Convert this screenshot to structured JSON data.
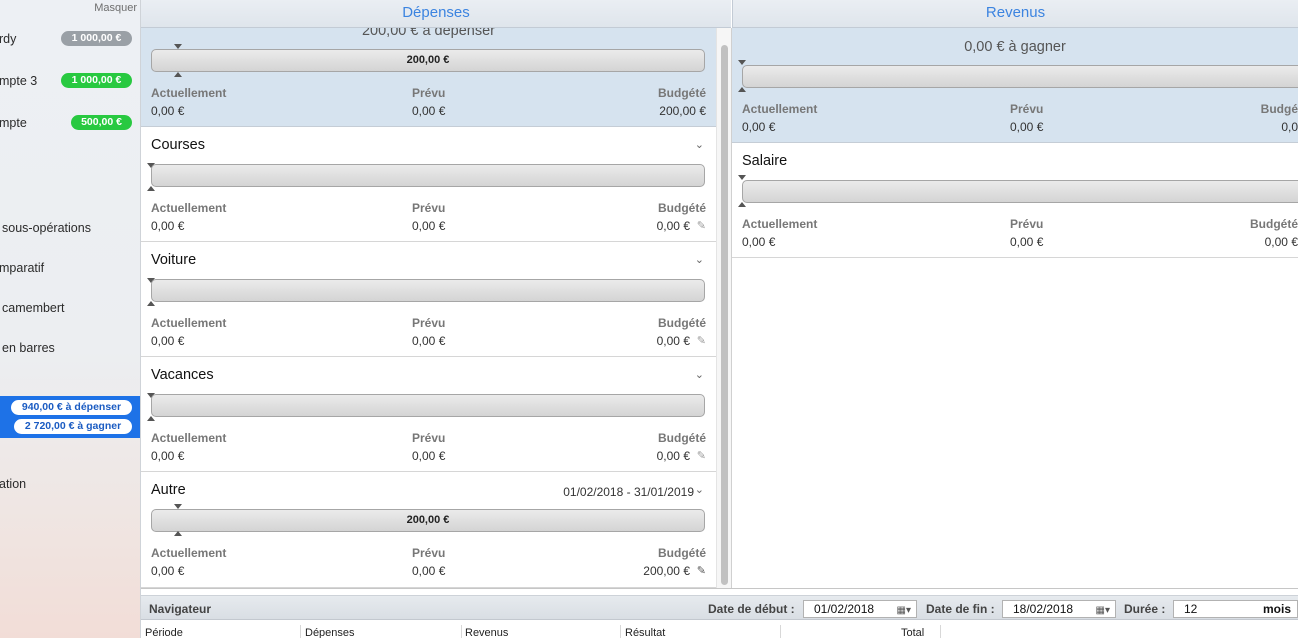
{
  "sidebar": {
    "hide_label": "Masquer",
    "accounts": [
      {
        "name": "rdy",
        "balance": "1 000,00 €",
        "color": "#9aa0a6"
      },
      {
        "name": "mpte 3",
        "balance": "1 000,00 €",
        "color": "#28c940"
      },
      {
        "name": "mpte",
        "balance": "500,00 €",
        "color": "#28c940"
      }
    ],
    "reports": [
      "sous-opérations",
      "mparatif",
      "camembert",
      "en barres"
    ],
    "budget_spend": "940,00 € à dépenser",
    "budget_earn": "2 720,00 € à gagner",
    "last_item": "ation"
  },
  "depenses": {
    "header": "Dépenses",
    "summary": {
      "to_spend": "200,00 € à dépenser",
      "bar_label": "200,00 €",
      "current_label": "Actuellement",
      "planned_label": "Prévu",
      "budget_label": "Budgété",
      "current": "0,00 €",
      "planned": "0,00 €",
      "budget": "200,00 €"
    },
    "categories": [
      {
        "title": "Courses",
        "current": "0,00 €",
        "planned": "0,00 €",
        "budget": "0,00 €",
        "bar_label": ""
      },
      {
        "title": "Voiture",
        "current": "0,00 €",
        "planned": "0,00 €",
        "budget": "0,00 €",
        "bar_label": ""
      },
      {
        "title": "Vacances",
        "current": "0,00 €",
        "planned": "0,00 €",
        "budget": "0,00 €",
        "bar_label": ""
      },
      {
        "title": "Autre",
        "date_range": "01/02/2018 - 31/01/2019",
        "current": "0,00 €",
        "planned": "0,00 €",
        "budget": "200,00 €",
        "bar_label": "200,00 €"
      }
    ]
  },
  "revenus": {
    "header": "Revenus",
    "summary": {
      "to_earn": "0,00 € à gagner",
      "current_label": "Actuellement",
      "planned_label": "Prévu",
      "budget_label": "Budgé",
      "current": "0,00 €",
      "planned": "0,00 €",
      "budget": "0,0"
    },
    "categories": [
      {
        "title": "Salaire",
        "current_label": "Actuellement",
        "planned_label": "Prévu",
        "budget_label": "Budgété",
        "current": "0,00 €",
        "planned": "0,00 €",
        "budget": "0,00 €"
      }
    ]
  },
  "labels": {
    "current": "Actuellement",
    "planned": "Prévu",
    "budget": "Budgété"
  },
  "navigator": {
    "title": "Navigateur",
    "start_label": "Date de début :",
    "start_value": "01/02/2018",
    "end_label": "Date de fin :",
    "end_value": "18/02/2018",
    "duration_label": "Durée :",
    "duration_value": "12",
    "duration_unit": "mois",
    "columns": [
      "Période",
      "Dépenses",
      "Revenus",
      "Résultat",
      "Total"
    ]
  }
}
